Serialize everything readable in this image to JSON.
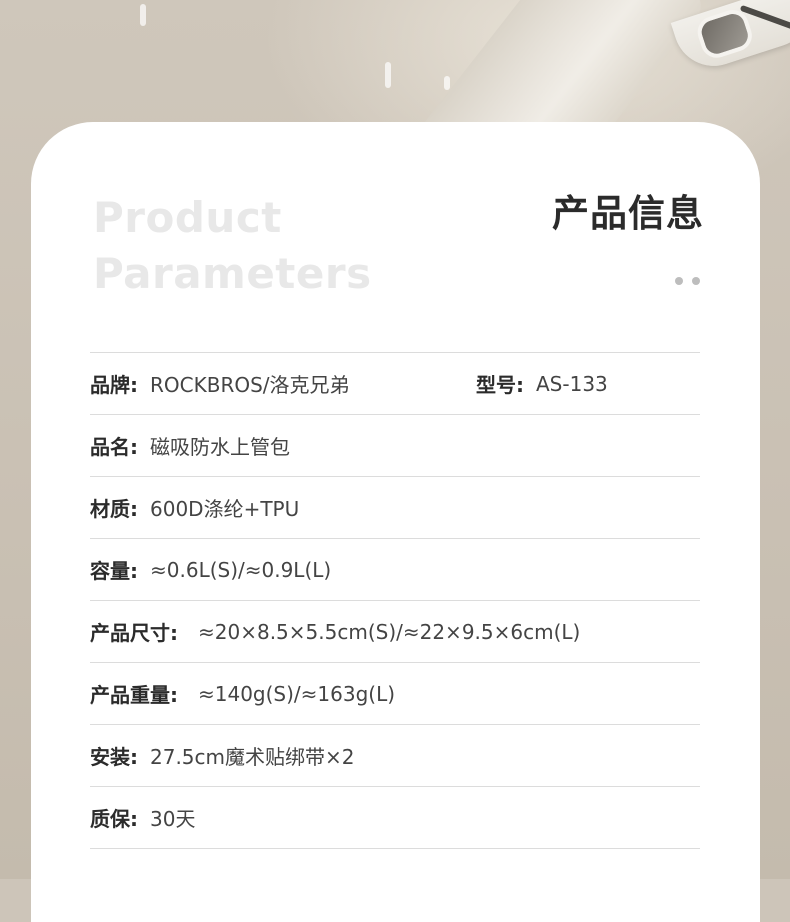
{
  "header": {
    "title_en_line1": "Product",
    "title_en_line2": "Parameters",
    "title_cn": "产品信息"
  },
  "params": {
    "brand_label": "品牌:",
    "brand_value": "ROCKBROS/洛克兄弟",
    "model_label": "型号:",
    "model_value": "AS-133",
    "name_label": "品名:",
    "name_value": "磁吸防水上管包",
    "material_label": "材质:",
    "material_value": "600D涤纶+TPU",
    "capacity_label": "容量:",
    "capacity_value": "≈0.6L(S)/≈0.9L(L)",
    "size_label": "产品尺寸:",
    "size_value": "≈20×8.5×5.5cm(S)/≈22×9.5×6cm(L)",
    "weight_label": "产品重量:",
    "weight_value": "≈140g(S)/≈163g(L)",
    "install_label": "安装:",
    "install_value": "27.5cm魔术贴绑带×2",
    "warranty_label": "质保:",
    "warranty_value": "30天"
  },
  "colors": {
    "card_background": "#ffffff",
    "title_en_color": "#e8e8e8",
    "title_cn_color": "#2b2b2b",
    "divider": "#dcdcdc"
  }
}
